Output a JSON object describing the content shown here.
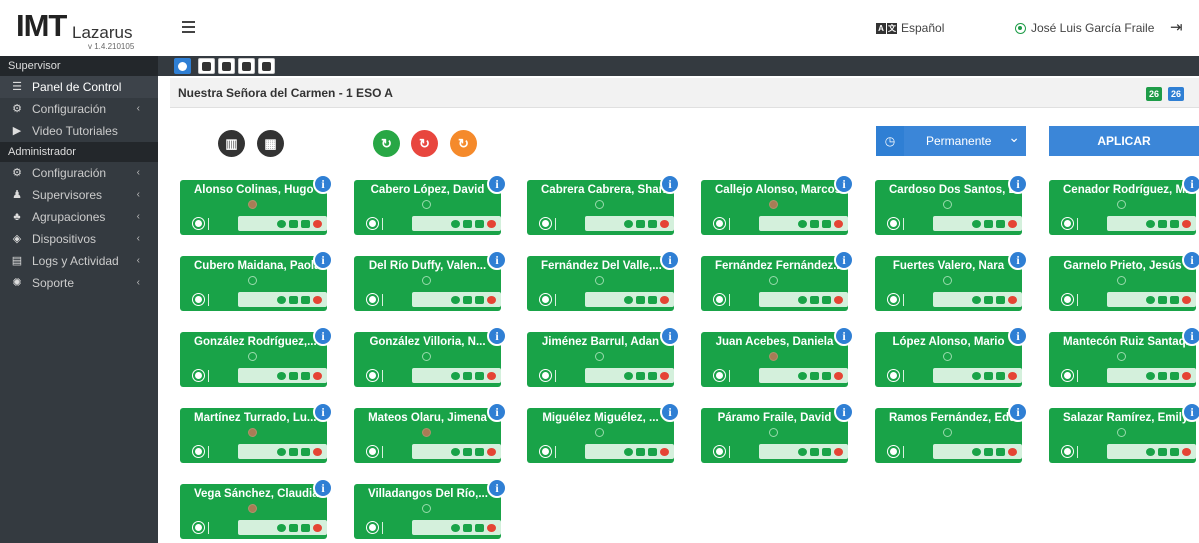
{
  "app": {
    "brand_main": "IMT",
    "brand_sub": "Lazarus",
    "version": "v 1.4.210105",
    "language": "Español",
    "user_name": "José Luis García Fraile"
  },
  "sidebar": {
    "section_supervisor": "Supervisor",
    "section_admin": "Administrador",
    "supervisor_items": [
      {
        "label": "Panel de Control",
        "icon": "list-icon"
      },
      {
        "label": "Configuración",
        "icon": "gears-icon"
      },
      {
        "label": "Video Tutoriales",
        "icon": "play-icon"
      }
    ],
    "admin_items": [
      {
        "label": "Configuración",
        "icon": "gears-icon"
      },
      {
        "label": "Supervisores",
        "icon": "users-icon"
      },
      {
        "label": "Agrupaciones",
        "icon": "group-icon"
      },
      {
        "label": "Dispositivos",
        "icon": "shield-icon"
      },
      {
        "label": "Logs y Actividad",
        "icon": "file-icon"
      },
      {
        "label": "Soporte",
        "icon": "gear-icon"
      }
    ]
  },
  "group": {
    "title": "Nuestra Señora del Carmen - 1 ESO A",
    "count_online": "26",
    "count_total": "26"
  },
  "controls": {
    "duration_value": "Permanente",
    "apply_label": "APLICAR"
  },
  "students": [
    {
      "name": "Alonso Colinas, Hugo",
      "status": "red"
    },
    {
      "name": "Cabero López, David",
      "status": "ok"
    },
    {
      "name": "Cabrera Cabrera, Shan...",
      "status": "ok"
    },
    {
      "name": "Callejo Alonso, Marcos",
      "status": "red"
    },
    {
      "name": "Cardoso Dos Santos, L...",
      "status": "ok"
    },
    {
      "name": "Cenador Rodríguez, M...",
      "status": "ok"
    },
    {
      "name": "Cubero Maidana, Paola",
      "status": "ok"
    },
    {
      "name": "Del Río Duffy, Valen...",
      "status": "ok"
    },
    {
      "name": "Fernández Del Valle,...",
      "status": "ok"
    },
    {
      "name": "Fernández Fernández...",
      "status": "ok"
    },
    {
      "name": "Fuertes Valero, Nara",
      "status": "ok"
    },
    {
      "name": "Garnelo Prieto, Jesús",
      "status": "ok"
    },
    {
      "name": "González Rodríguez,...",
      "status": "ok"
    },
    {
      "name": "González Villoria, N...",
      "status": "ok"
    },
    {
      "name": "Jiménez Barrul, Adan",
      "status": "ok"
    },
    {
      "name": "Juan Acebes, Daniela",
      "status": "red"
    },
    {
      "name": "López Alonso, Mario",
      "status": "ok"
    },
    {
      "name": "Mantecón Ruiz Santaq...",
      "status": "ok"
    },
    {
      "name": "Martínez Turrado, Lu...",
      "status": "red"
    },
    {
      "name": "Mateos Olaru, Jimena",
      "status": "red"
    },
    {
      "name": "Miguélez Miguélez, ...",
      "status": "ok"
    },
    {
      "name": "Páramo Fraile, David",
      "status": "ok"
    },
    {
      "name": "Ramos Fernández, Edu...",
      "status": "ok"
    },
    {
      "name": "Salazar Ramírez, Emily",
      "status": "ok"
    },
    {
      "name": "Vega Sánchez, Claudia",
      "status": "red"
    },
    {
      "name": "Villadangos Del Río,...",
      "status": "ok"
    }
  ]
}
